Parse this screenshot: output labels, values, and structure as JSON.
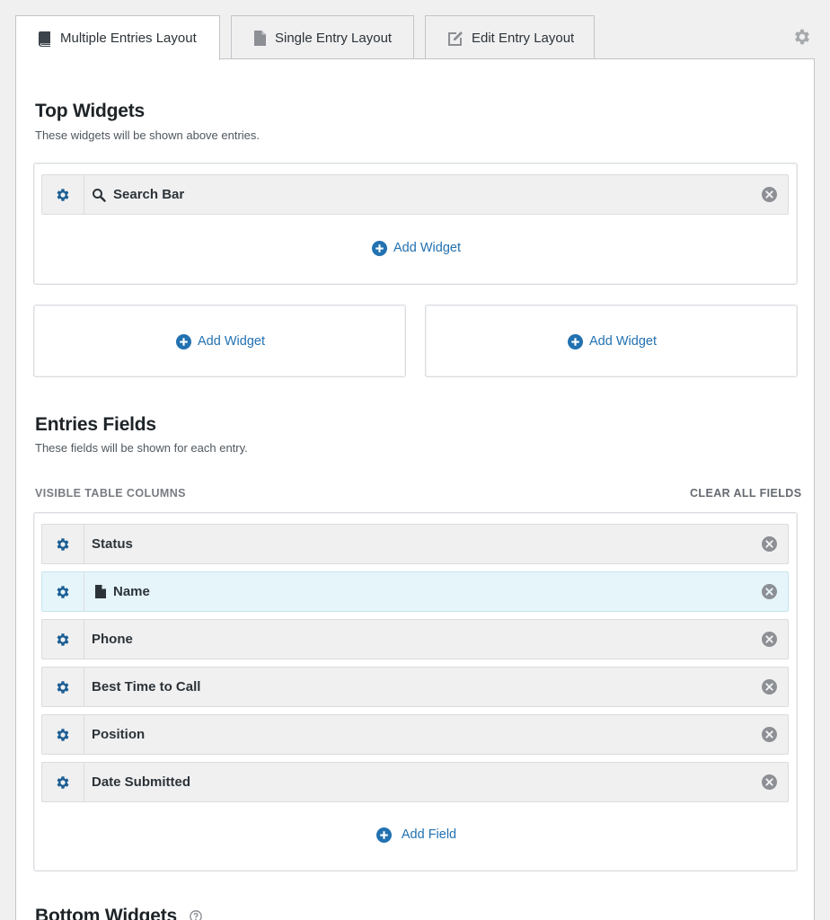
{
  "tabs": [
    {
      "label": "Multiple Entries Layout",
      "icon": "book-icon",
      "active": true
    },
    {
      "label": "Single Entry Layout",
      "icon": "document-icon",
      "active": false
    },
    {
      "label": "Edit Entry Layout",
      "icon": "edit-icon",
      "active": false
    }
  ],
  "top_widgets": {
    "title": "Top Widgets",
    "description": "These widgets will be shown above entries.",
    "main_zone": {
      "items": [
        {
          "label": "Search Bar",
          "icon": "search-icon"
        }
      ],
      "add_label": "Add Widget"
    },
    "left_zone": {
      "add_label": "Add Widget"
    },
    "right_zone": {
      "add_label": "Add Widget"
    }
  },
  "entries_fields": {
    "title": "Entries Fields",
    "description": "These fields will be shown for each entry.",
    "columns_label": "VISIBLE TABLE COLUMNS",
    "clear_label": "CLEAR ALL FIELDS",
    "fields": [
      {
        "label": "Status"
      },
      {
        "label": "Name",
        "icon": "document-icon",
        "highlighted": true
      },
      {
        "label": "Phone"
      },
      {
        "label": "Best Time to Call"
      },
      {
        "label": "Position"
      },
      {
        "label": "Date Submitted"
      }
    ],
    "add_label": "Add Field"
  },
  "bottom_widgets": {
    "title": "Bottom Widgets"
  },
  "colors": {
    "accent": "#2271b1",
    "gear": "#1c5e94",
    "highlight_row": "#e5f5fa"
  }
}
